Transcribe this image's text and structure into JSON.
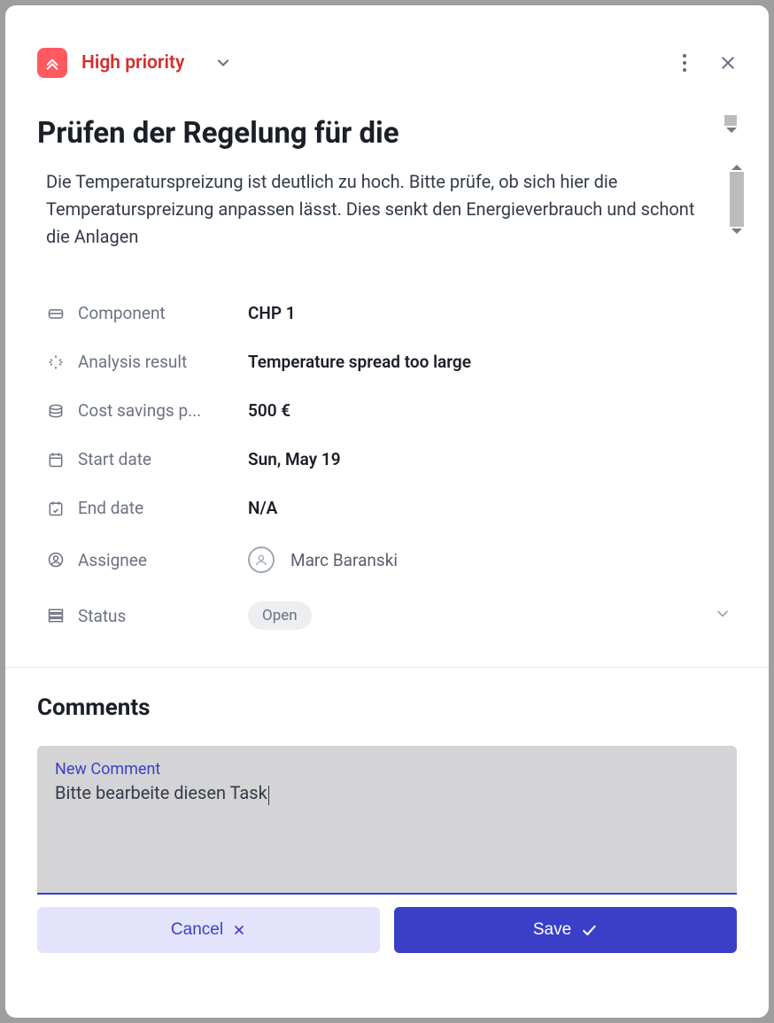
{
  "priority": {
    "label": "High priority"
  },
  "title": "Prüfen der Regelung für die",
  "description": "Die Temperaturspreizung ist deutlich zu hoch. Bitte prüfe, ob sich hier die Temperaturspreizung anpassen lässt. Dies senkt den Energieverbrauch und schont die Anlagen",
  "props": {
    "component": {
      "label": "Component",
      "value": "CHP 1"
    },
    "analysis": {
      "label": "Analysis result",
      "value": "Temperature spread too large"
    },
    "savings": {
      "label": "Cost savings p...",
      "value": "500 €"
    },
    "start_date": {
      "label": "Start date",
      "value": "Sun, May 19"
    },
    "end_date": {
      "label": "End date",
      "value": "N/A"
    },
    "assignee": {
      "label": "Assignee",
      "value": "Marc Baranski"
    },
    "status": {
      "label": "Status",
      "value": "Open"
    }
  },
  "comments": {
    "heading": "Comments",
    "new_label": "New Comment",
    "draft": "Bitte bearbeite diesen Task"
  },
  "buttons": {
    "cancel": "Cancel",
    "save": "Save"
  }
}
